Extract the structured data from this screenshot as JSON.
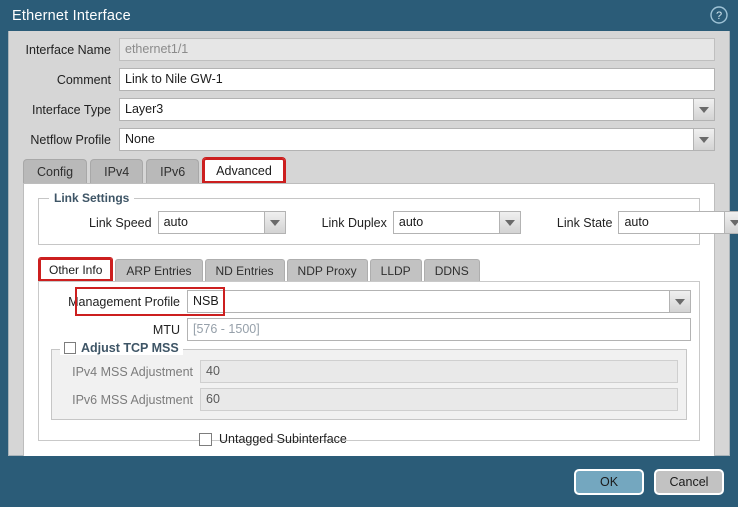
{
  "window": {
    "title": "Ethernet Interface",
    "help_icon": "help-circle-icon",
    "accent_color": "#2b5c78",
    "highlight_color": "#cc1f1f"
  },
  "header_form": {
    "fields": [
      {
        "label": "Interface Name",
        "value": "ethernet1/1",
        "type": "readonly-text"
      },
      {
        "label": "Comment",
        "value": "Link to Nile GW-1",
        "type": "text"
      },
      {
        "label": "Interface Type",
        "value": "Layer3",
        "type": "dropdown"
      },
      {
        "label": "Netflow Profile",
        "value": "None",
        "type": "dropdown"
      }
    ]
  },
  "main_tabs": {
    "items": [
      {
        "label": "Config",
        "active": false,
        "highlighted": false
      },
      {
        "label": "IPv4",
        "active": false,
        "highlighted": false
      },
      {
        "label": "IPv6",
        "active": false,
        "highlighted": false
      },
      {
        "label": "Advanced",
        "active": true,
        "highlighted": true
      }
    ]
  },
  "link_settings": {
    "legend": "Link Settings",
    "fields": [
      {
        "label": "Link Speed",
        "value": "auto"
      },
      {
        "label": "Link Duplex",
        "value": "auto"
      },
      {
        "label": "Link State",
        "value": "auto"
      }
    ]
  },
  "sub_tabs": {
    "items": [
      {
        "label": "Other Info",
        "active": true,
        "highlighted": true
      },
      {
        "label": "ARP Entries",
        "active": false,
        "highlighted": false
      },
      {
        "label": "ND Entries",
        "active": false,
        "highlighted": false
      },
      {
        "label": "NDP Proxy",
        "active": false,
        "highlighted": false
      },
      {
        "label": "LLDP",
        "active": false,
        "highlighted": false
      },
      {
        "label": "DDNS",
        "active": false,
        "highlighted": false
      }
    ]
  },
  "other_info": {
    "management_profile": {
      "label": "Management Profile",
      "value": "NSB",
      "highlighted": true
    },
    "mtu": {
      "label": "MTU",
      "value": "",
      "placeholder": "[576 - 1500]"
    },
    "adjust_tcp_mss": {
      "legend": "Adjust TCP MSS",
      "checked": false,
      "fields": [
        {
          "label": "IPv4 MSS Adjustment",
          "value": "40",
          "disabled": true
        },
        {
          "label": "IPv6 MSS Adjustment",
          "value": "60",
          "disabled": true
        }
      ]
    },
    "untagged_subinterface": {
      "label": "Untagged Subinterface",
      "checked": false
    }
  },
  "footer": {
    "ok_label": "OK",
    "cancel_label": "Cancel"
  }
}
